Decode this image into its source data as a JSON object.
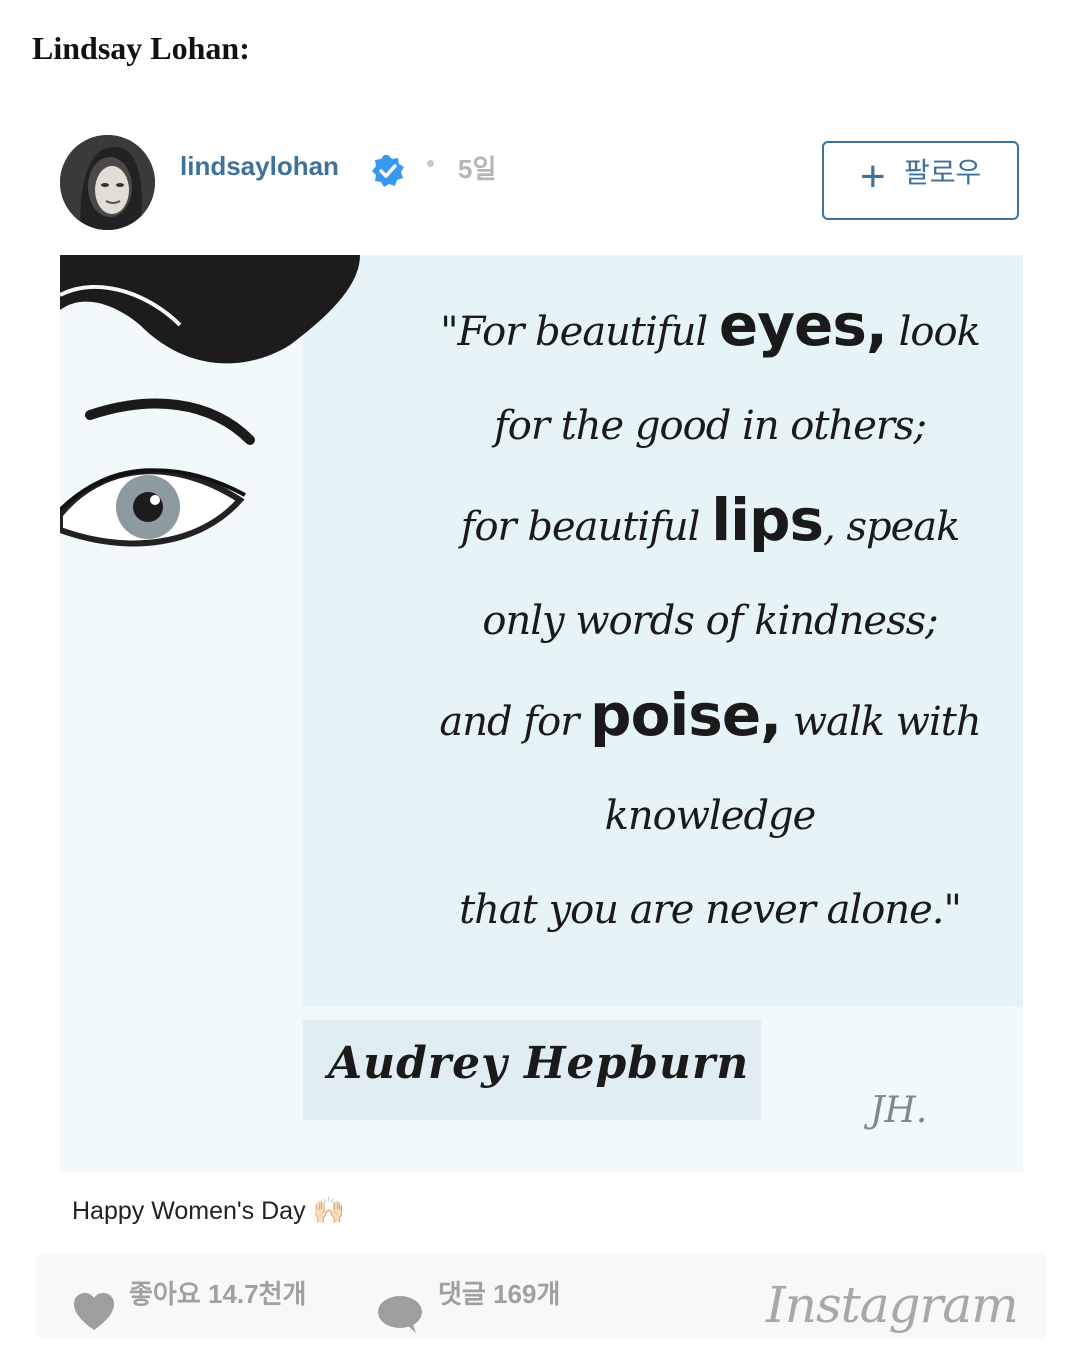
{
  "headline": "Lindsay Lohan:",
  "post": {
    "username": "lindsaylohan",
    "time": "5일",
    "follow_label": "팔로우",
    "follow_icon": "plus-icon",
    "verified_icon": "verified-badge-icon",
    "quote_lines": [
      {
        "pre": "\"For beautiful ",
        "em": "eyes,",
        "post": " look"
      },
      {
        "pre": "for the good in others;",
        "em": "",
        "post": ""
      },
      {
        "pre": "for beautiful ",
        "em": "lips",
        "post": ", speak"
      },
      {
        "pre": "only words of kindness;",
        "em": "",
        "post": ""
      },
      {
        "pre": "and for ",
        "em": "poise,",
        "post": " walk with"
      },
      {
        "pre": "knowledge",
        "em": "",
        "post": ""
      },
      {
        "pre": "that you are never alone.\"",
        "em": "",
        "post": ""
      }
    ],
    "author": "Audrey Hepburn",
    "signature": "JH.",
    "caption": "Happy Women's Day",
    "caption_emoji": "🙌🏻"
  },
  "footer": {
    "likes": "좋아요 14.7천개",
    "comments": "댓글 169개",
    "brand": "Instagram",
    "like_icon": "heart-icon",
    "comment_icon": "comment-bubble-icon"
  },
  "colors": {
    "link_blue": "#3f729b",
    "verified_blue": "#3897f0",
    "muted_gray": "#a0a0a0"
  }
}
